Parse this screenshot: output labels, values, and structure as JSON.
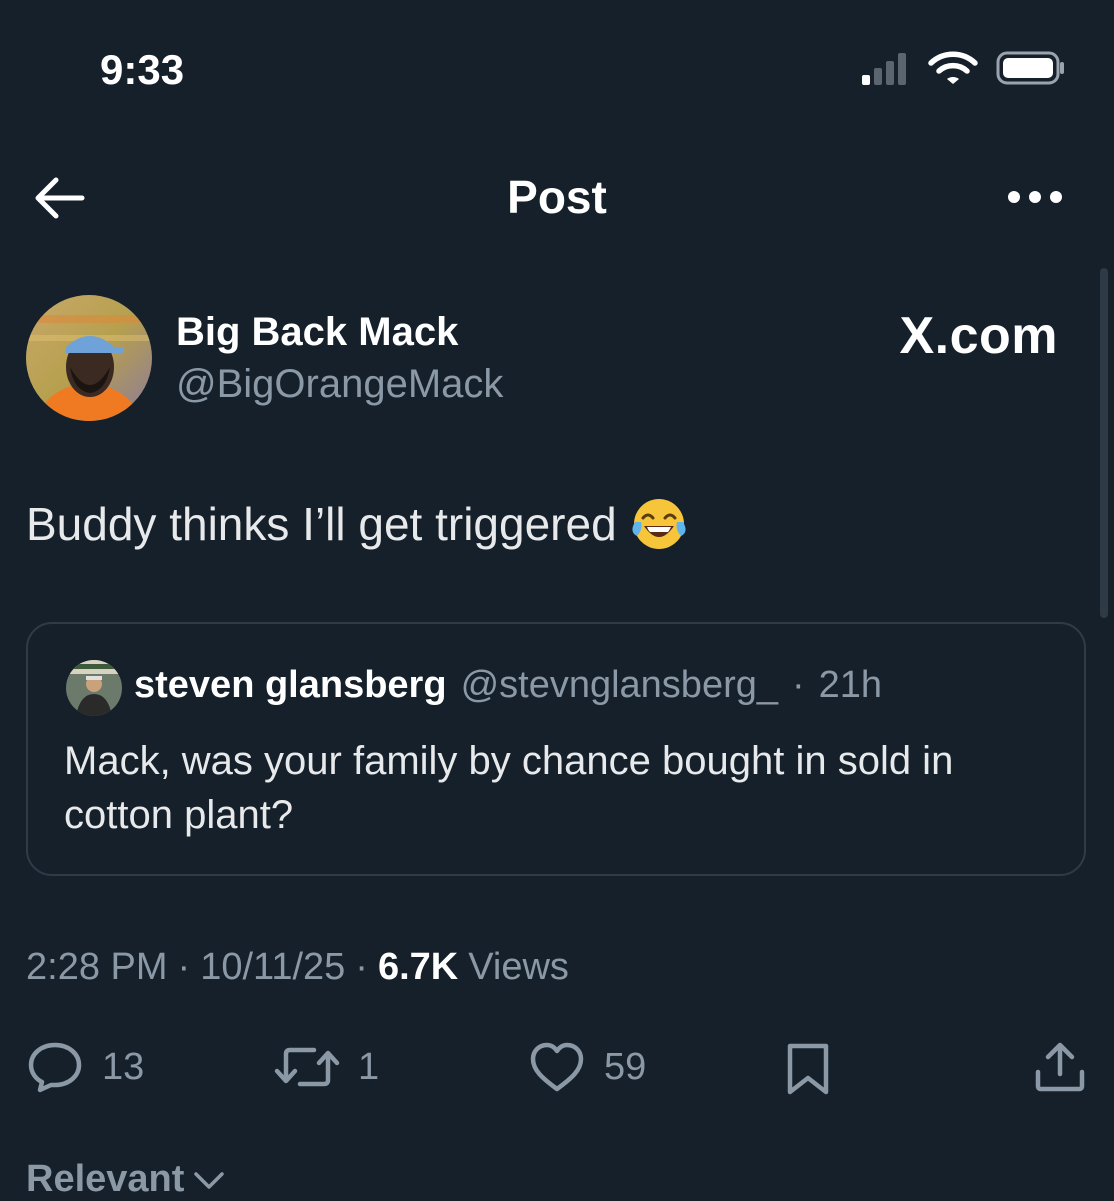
{
  "status_bar": {
    "time": "9:33"
  },
  "nav": {
    "title": "Post"
  },
  "post": {
    "author_name": "Big Back Mack",
    "author_handle": "@BigOrangeMack",
    "brand": "X.com",
    "text": "Buddy thinks I’ll get triggered",
    "emoji_icon": "face-with-tears-of-joy-icon"
  },
  "quoted_post": {
    "author_name": "steven glansberg",
    "author_handle": "@stevnglansberg_",
    "separator": "·",
    "age": "21h",
    "text": "Mack, was your family by chance bought in sold in cotton plant?"
  },
  "meta": {
    "time": "2:28 PM",
    "separator": "·",
    "date": "10/11/25",
    "views_count": "6.7K",
    "views_label": "Views"
  },
  "actions": {
    "replies": "13",
    "reposts": "1",
    "likes": "59"
  },
  "sort": {
    "label": "Relevant"
  },
  "colors": {
    "background": "#15202b",
    "text": "#e7e9ea",
    "muted": "#8b98a5",
    "border": "#2f3b47"
  }
}
